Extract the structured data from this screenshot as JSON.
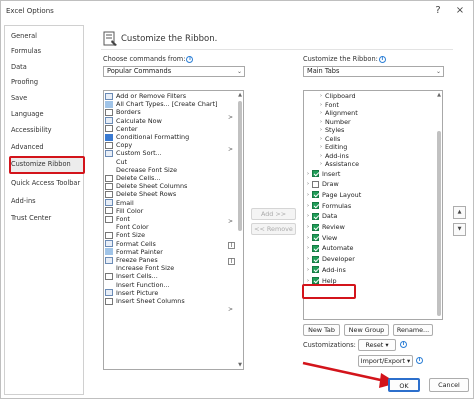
{
  "window": {
    "title": "Excel Options",
    "help": "?",
    "close": "×"
  },
  "sidebar": {
    "items": [
      "General",
      "Formulas",
      "Data",
      "Proofing",
      "Save",
      "Language",
      "Accessibility",
      "Advanced",
      "Customize Ribbon",
      "Quick Access Toolbar",
      "Add-ins",
      "Trust Center"
    ],
    "selected_index": 8
  },
  "header": {
    "title": "Customize the Ribbon."
  },
  "left_panel": {
    "label": "Choose commands from:",
    "dropdown_value": "Popular Commands",
    "commands": [
      "Add or Remove Filters",
      "All Chart Types... [Create Chart]",
      "Borders",
      "Calculate Now",
      "Center",
      "Conditional Formatting",
      "Copy",
      "Custom Sort...",
      "Cut",
      "Decrease Font Size",
      "Delete Cells...",
      "Delete Sheet Columns",
      "Delete Sheet Rows",
      "Email",
      "Fill Color",
      "Font",
      "Font Color",
      "Font Size",
      "Format Cells",
      "Format Painter",
      "Freeze Panes",
      "Increase Font Size",
      "Insert Cells...",
      "Insert Function...",
      "Insert Picture",
      "Insert Sheet Columns"
    ]
  },
  "middle": {
    "add_label": "Add >>",
    "remove_label": "<< Remove"
  },
  "right_panel": {
    "label": "Customize the Ribbon:",
    "dropdown_value": "Main Tabs",
    "groups": [
      "Clipboard",
      "Font",
      "Alignment",
      "Number",
      "Styles",
      "Cells",
      "Editing",
      "Add-ins",
      "Assistance"
    ],
    "tabs": [
      {
        "name": "Insert",
        "checked": true
      },
      {
        "name": "Draw",
        "checked": false
      },
      {
        "name": "Page Layout",
        "checked": true
      },
      {
        "name": "Formulas",
        "checked": true
      },
      {
        "name": "Data",
        "checked": true
      },
      {
        "name": "Review",
        "checked": true
      },
      {
        "name": "View",
        "checked": true
      },
      {
        "name": "Automate",
        "checked": true
      },
      {
        "name": "Developer",
        "checked": true
      },
      {
        "name": "Add-ins",
        "checked": true
      },
      {
        "name": "Help",
        "checked": true
      }
    ],
    "new_tab_label": "New Tab",
    "new_group_label": "New Group",
    "rename_label": "Rename...",
    "customizations_label": "Customizations:",
    "reset_label": "Reset ▾",
    "import_export_label": "Import/Export ▾"
  },
  "footer": {
    "ok_label": "OK",
    "cancel_label": "Cancel"
  },
  "colors": {
    "highlight": "#d3141b",
    "checkbox": "#1f9d57",
    "selected_bg": "#ececec"
  }
}
